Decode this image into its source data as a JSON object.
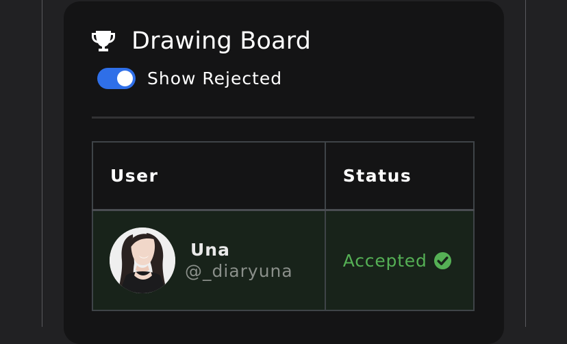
{
  "card": {
    "title": "Drawing Board",
    "title_icon": "trophy-icon",
    "toggle": {
      "label": "Show Rejected",
      "on": true,
      "color": "#2f6fe8"
    }
  },
  "table": {
    "headers": {
      "user": "User",
      "status": "Status"
    },
    "rows": [
      {
        "name": "Una",
        "handle": "@_diaryuna",
        "status": "Accepted",
        "status_icon": "check-circle-icon",
        "status_color": "#55b055"
      }
    ]
  }
}
